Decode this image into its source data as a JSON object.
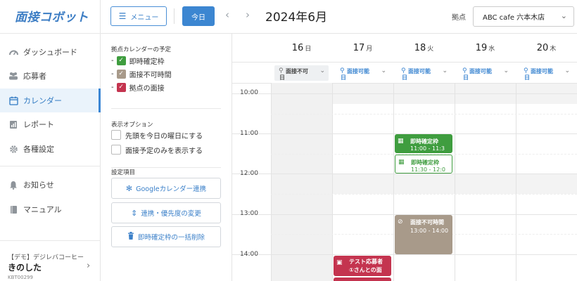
{
  "app": {
    "logo": "面接コボット"
  },
  "sidebar": {
    "items": [
      {
        "label": "ダッシュボード",
        "icon": "dashboard-icon"
      },
      {
        "label": "応募者",
        "icon": "users-icon"
      },
      {
        "label": "カレンダー",
        "icon": "calendar-icon",
        "active": true
      },
      {
        "label": "レポート",
        "icon": "report-icon"
      },
      {
        "label": "各種設定",
        "icon": "gear-icon"
      },
      {
        "label": "お知らせ",
        "icon": "bell-icon"
      },
      {
        "label": "マニュアル",
        "icon": "book-icon"
      }
    ],
    "shop": {
      "company": "【デモ】デジレバコーヒー",
      "user": "きのした",
      "code": "KBT00299"
    }
  },
  "toolbar": {
    "menu_label": "メニュー",
    "today_label": "今日",
    "prev": "‹",
    "next": "›",
    "month": "2024年6月",
    "location_label": "拠点",
    "location_value": "ABC cafe 六本木店",
    "location_chevron": "⌄"
  },
  "panel": {
    "legend_title": "拠点カレンダーの予定",
    "legend": [
      {
        "label": "即時確定枠",
        "color": "#3f9d3f"
      },
      {
        "label": "面接不可時間",
        "color": "#a89a8a"
      },
      {
        "label": "拠点の面接",
        "color": "#c4344f"
      }
    ],
    "display_title": "表示オプション",
    "display_options": [
      {
        "label": "先頭を今日の曜日にする",
        "checked": false
      },
      {
        "label": "面接予定のみを表示する",
        "checked": false
      }
    ],
    "settings_title": "設定項目",
    "settings_buttons": [
      {
        "label": "Googleカレンダー連携",
        "icon": "gear-icon"
      },
      {
        "label": "連携・優先度の変更",
        "icon": "sort-icon"
      },
      {
        "label": "即時確定枠の一括削除",
        "icon": "trash-icon"
      }
    ]
  },
  "calendar": {
    "days": [
      {
        "num": "16",
        "weekday": "日",
        "status": "面接不可",
        "status_suffix": "日",
        "available": false
      },
      {
        "num": "17",
        "weekday": "月",
        "status": "面接可能",
        "status_suffix": "日",
        "available": true
      },
      {
        "num": "18",
        "weekday": "火",
        "status": "面接可能",
        "status_suffix": "日",
        "available": true
      },
      {
        "num": "19",
        "weekday": "水",
        "status": "面接可能",
        "status_suffix": "日",
        "available": true
      },
      {
        "num": "20",
        "weekday": "木",
        "status": "面接可能",
        "status_suffix": "日",
        "available": true
      }
    ],
    "times": [
      "10:00",
      "11:00",
      "12:00",
      "13:00",
      "14:00"
    ],
    "events": [
      {
        "title": "即時確定枠",
        "time": "11:00 - 11:3",
        "type": "green-solid"
      },
      {
        "title": "即時確定枠",
        "time": "11:30 - 12:0",
        "type": "green-outline"
      },
      {
        "title": "面接不可時間",
        "time": "13:00 - 14:00",
        "type": "gray"
      },
      {
        "title": "テスト応募者",
        "time": "①さんとの面",
        "type": "red"
      }
    ]
  }
}
